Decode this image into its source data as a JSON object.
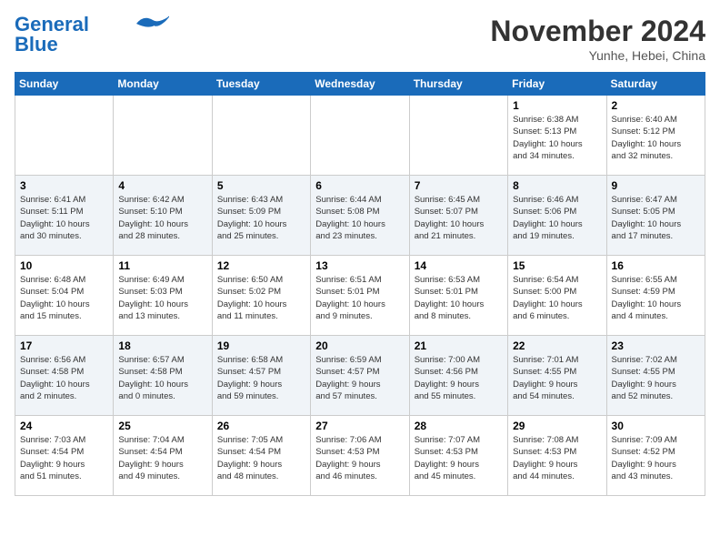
{
  "header": {
    "logo_line1": "General",
    "logo_line2": "Blue",
    "month": "November 2024",
    "location": "Yunhe, Hebei, China"
  },
  "weekdays": [
    "Sunday",
    "Monday",
    "Tuesday",
    "Wednesday",
    "Thursday",
    "Friday",
    "Saturday"
  ],
  "weeks": [
    [
      {
        "day": "",
        "info": ""
      },
      {
        "day": "",
        "info": ""
      },
      {
        "day": "",
        "info": ""
      },
      {
        "day": "",
        "info": ""
      },
      {
        "day": "",
        "info": ""
      },
      {
        "day": "1",
        "info": "Sunrise: 6:38 AM\nSunset: 5:13 PM\nDaylight: 10 hours\nand 34 minutes."
      },
      {
        "day": "2",
        "info": "Sunrise: 6:40 AM\nSunset: 5:12 PM\nDaylight: 10 hours\nand 32 minutes."
      }
    ],
    [
      {
        "day": "3",
        "info": "Sunrise: 6:41 AM\nSunset: 5:11 PM\nDaylight: 10 hours\nand 30 minutes."
      },
      {
        "day": "4",
        "info": "Sunrise: 6:42 AM\nSunset: 5:10 PM\nDaylight: 10 hours\nand 28 minutes."
      },
      {
        "day": "5",
        "info": "Sunrise: 6:43 AM\nSunset: 5:09 PM\nDaylight: 10 hours\nand 25 minutes."
      },
      {
        "day": "6",
        "info": "Sunrise: 6:44 AM\nSunset: 5:08 PM\nDaylight: 10 hours\nand 23 minutes."
      },
      {
        "day": "7",
        "info": "Sunrise: 6:45 AM\nSunset: 5:07 PM\nDaylight: 10 hours\nand 21 minutes."
      },
      {
        "day": "8",
        "info": "Sunrise: 6:46 AM\nSunset: 5:06 PM\nDaylight: 10 hours\nand 19 minutes."
      },
      {
        "day": "9",
        "info": "Sunrise: 6:47 AM\nSunset: 5:05 PM\nDaylight: 10 hours\nand 17 minutes."
      }
    ],
    [
      {
        "day": "10",
        "info": "Sunrise: 6:48 AM\nSunset: 5:04 PM\nDaylight: 10 hours\nand 15 minutes."
      },
      {
        "day": "11",
        "info": "Sunrise: 6:49 AM\nSunset: 5:03 PM\nDaylight: 10 hours\nand 13 minutes."
      },
      {
        "day": "12",
        "info": "Sunrise: 6:50 AM\nSunset: 5:02 PM\nDaylight: 10 hours\nand 11 minutes."
      },
      {
        "day": "13",
        "info": "Sunrise: 6:51 AM\nSunset: 5:01 PM\nDaylight: 10 hours\nand 9 minutes."
      },
      {
        "day": "14",
        "info": "Sunrise: 6:53 AM\nSunset: 5:01 PM\nDaylight: 10 hours\nand 8 minutes."
      },
      {
        "day": "15",
        "info": "Sunrise: 6:54 AM\nSunset: 5:00 PM\nDaylight: 10 hours\nand 6 minutes."
      },
      {
        "day": "16",
        "info": "Sunrise: 6:55 AM\nSunset: 4:59 PM\nDaylight: 10 hours\nand 4 minutes."
      }
    ],
    [
      {
        "day": "17",
        "info": "Sunrise: 6:56 AM\nSunset: 4:58 PM\nDaylight: 10 hours\nand 2 minutes."
      },
      {
        "day": "18",
        "info": "Sunrise: 6:57 AM\nSunset: 4:58 PM\nDaylight: 10 hours\nand 0 minutes."
      },
      {
        "day": "19",
        "info": "Sunrise: 6:58 AM\nSunset: 4:57 PM\nDaylight: 9 hours\nand 59 minutes."
      },
      {
        "day": "20",
        "info": "Sunrise: 6:59 AM\nSunset: 4:57 PM\nDaylight: 9 hours\nand 57 minutes."
      },
      {
        "day": "21",
        "info": "Sunrise: 7:00 AM\nSunset: 4:56 PM\nDaylight: 9 hours\nand 55 minutes."
      },
      {
        "day": "22",
        "info": "Sunrise: 7:01 AM\nSunset: 4:55 PM\nDaylight: 9 hours\nand 54 minutes."
      },
      {
        "day": "23",
        "info": "Sunrise: 7:02 AM\nSunset: 4:55 PM\nDaylight: 9 hours\nand 52 minutes."
      }
    ],
    [
      {
        "day": "24",
        "info": "Sunrise: 7:03 AM\nSunset: 4:54 PM\nDaylight: 9 hours\nand 51 minutes."
      },
      {
        "day": "25",
        "info": "Sunrise: 7:04 AM\nSunset: 4:54 PM\nDaylight: 9 hours\nand 49 minutes."
      },
      {
        "day": "26",
        "info": "Sunrise: 7:05 AM\nSunset: 4:54 PM\nDaylight: 9 hours\nand 48 minutes."
      },
      {
        "day": "27",
        "info": "Sunrise: 7:06 AM\nSunset: 4:53 PM\nDaylight: 9 hours\nand 46 minutes."
      },
      {
        "day": "28",
        "info": "Sunrise: 7:07 AM\nSunset: 4:53 PM\nDaylight: 9 hours\nand 45 minutes."
      },
      {
        "day": "29",
        "info": "Sunrise: 7:08 AM\nSunset: 4:53 PM\nDaylight: 9 hours\nand 44 minutes."
      },
      {
        "day": "30",
        "info": "Sunrise: 7:09 AM\nSunset: 4:52 PM\nDaylight: 9 hours\nand 43 minutes."
      }
    ]
  ]
}
